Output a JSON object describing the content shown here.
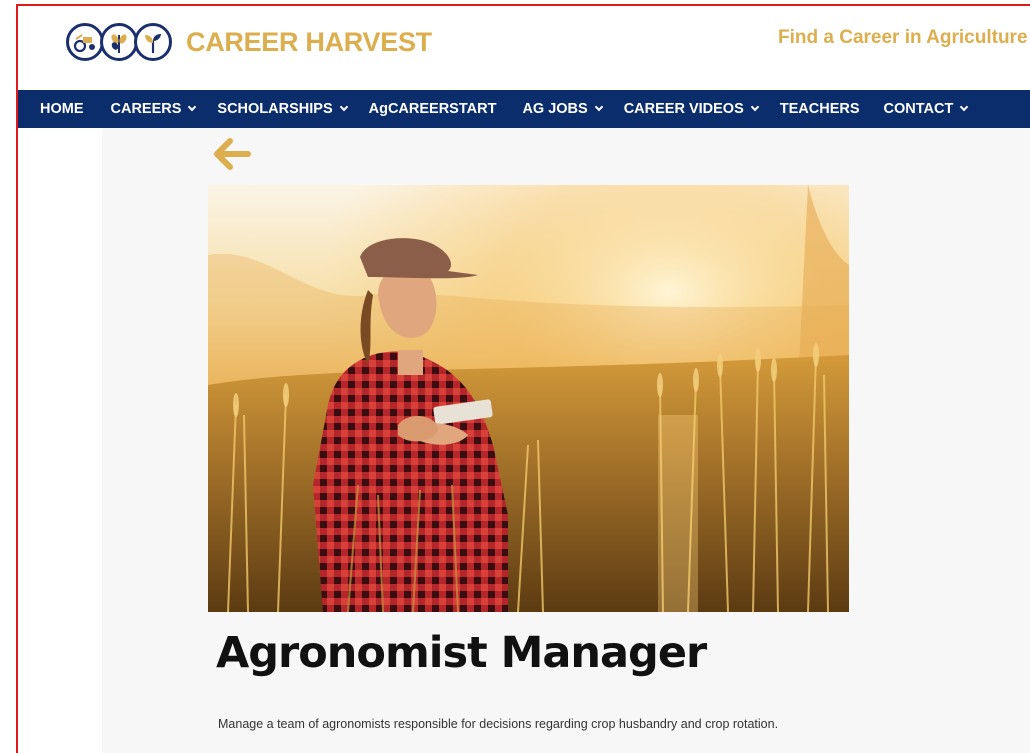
{
  "header": {
    "logo_text": "CAREER HARVEST",
    "tagline": "Find a Career in Agriculture",
    "brand_gold": "#dcae4d",
    "brand_navy": "#0c2d6c"
  },
  "nav": {
    "items": [
      {
        "label": "HOME",
        "dropdown": false
      },
      {
        "label": "CAREERS",
        "dropdown": true
      },
      {
        "label": "SCHOLARSHIPS",
        "dropdown": true
      },
      {
        "label": "AgCAREERSTART",
        "dropdown": false
      },
      {
        "label": "AG JOBS",
        "dropdown": true
      },
      {
        "label": "CAREER VIDEOS",
        "dropdown": true
      },
      {
        "label": "TEACHERS",
        "dropdown": false
      },
      {
        "label": "CONTACT",
        "dropdown": true
      }
    ]
  },
  "page": {
    "back_icon": "arrow-left-icon",
    "title": "Agronomist Manager",
    "description": "Manage a team of agronomists responsible for decisions regarding crop husbandry and crop rotation."
  }
}
